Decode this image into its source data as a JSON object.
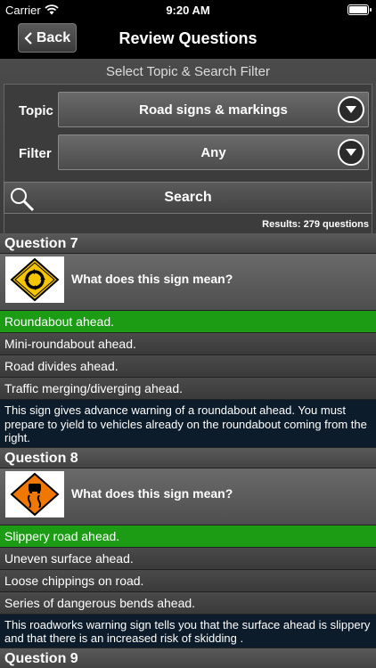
{
  "status": {
    "carrier": "Carrier",
    "time": "9:20 AM"
  },
  "nav": {
    "back_label": "Back",
    "title": "Review Questions"
  },
  "filter": {
    "header": "Select Topic & Search Filter",
    "topic_label": "Topic",
    "topic_value": "Road signs & markings",
    "filter_label": "Filter",
    "filter_value": "Any"
  },
  "search": {
    "label": "Search",
    "results": "Results: 279 questions"
  },
  "questions": [
    {
      "title": "Question 7",
      "prompt": "What does this sign mean?",
      "answers": [
        "Roundabout ahead.",
        "Mini-roundabout ahead.",
        "Road divides ahead.",
        "Traffic merging/diverging ahead."
      ],
      "explanation": "This sign gives advance warning of a roundabout ahead. You must prepare to yield to vehicles already on the roundabout coming from the right."
    },
    {
      "title": "Question 8",
      "prompt": "What does this sign mean?",
      "answers": [
        "Slippery road ahead.",
        "Uneven surface ahead.",
        "Loose chippings on road.",
        "Series of dangerous bends ahead."
      ],
      "explanation": "This roadworks warning sign tells you that the surface ahead is slippery and that there is an increased risk of skidding ."
    },
    {
      "title": "Question 9"
    }
  ],
  "colors": {
    "correct": "#1b9c14",
    "explanation_bg": "#0c1c2a",
    "sign_yellow": "#f5c400",
    "sign_orange": "#f07800"
  }
}
